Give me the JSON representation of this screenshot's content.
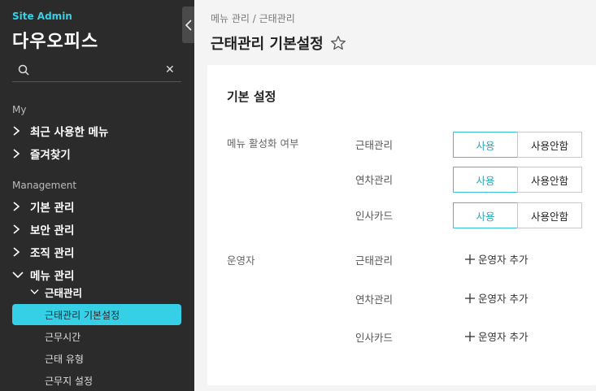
{
  "sidebar": {
    "brand_sub": "Site Admin",
    "brand_title": "다우오피스",
    "search": {
      "value": "",
      "placeholder": ""
    },
    "sections": {
      "my": "My",
      "management": "Management"
    },
    "my_items": [
      {
        "label": "최근 사용한 메뉴"
      },
      {
        "label": "즐겨찾기"
      }
    ],
    "mgmt_items": [
      {
        "label": "기본 관리"
      },
      {
        "label": "보안 관리"
      },
      {
        "label": "조직 관리"
      },
      {
        "label": "메뉴 관리"
      }
    ],
    "submenu": {
      "label": "근태관리",
      "items": [
        {
          "label": "근태관리 기본설정",
          "active": true
        },
        {
          "label": "근무시간"
        },
        {
          "label": "근태 유형"
        },
        {
          "label": "근무지 설정"
        }
      ]
    },
    "accent_color": "#35d0e6"
  },
  "header": {
    "breadcrumb": "메뉴 관리 / 근태관리",
    "title": "근태관리 기본설정"
  },
  "card": {
    "title": "기본 설정",
    "activation": {
      "label": "메뉴 활성화 여부",
      "rows": [
        {
          "name": "근태관리",
          "on": "사용",
          "off": "사용안함"
        },
        {
          "name": "연차관리",
          "on": "사용",
          "off": "사용안함"
        },
        {
          "name": "인사카드",
          "on": "사용",
          "off": "사용안함"
        }
      ]
    },
    "operators": {
      "label": "운영자",
      "rows": [
        {
          "name": "근태관리",
          "action": "운영자 추가"
        },
        {
          "name": "연차관리",
          "action": "운영자 추가"
        },
        {
          "name": "인사카드",
          "action": "운영자 추가"
        }
      ]
    }
  }
}
